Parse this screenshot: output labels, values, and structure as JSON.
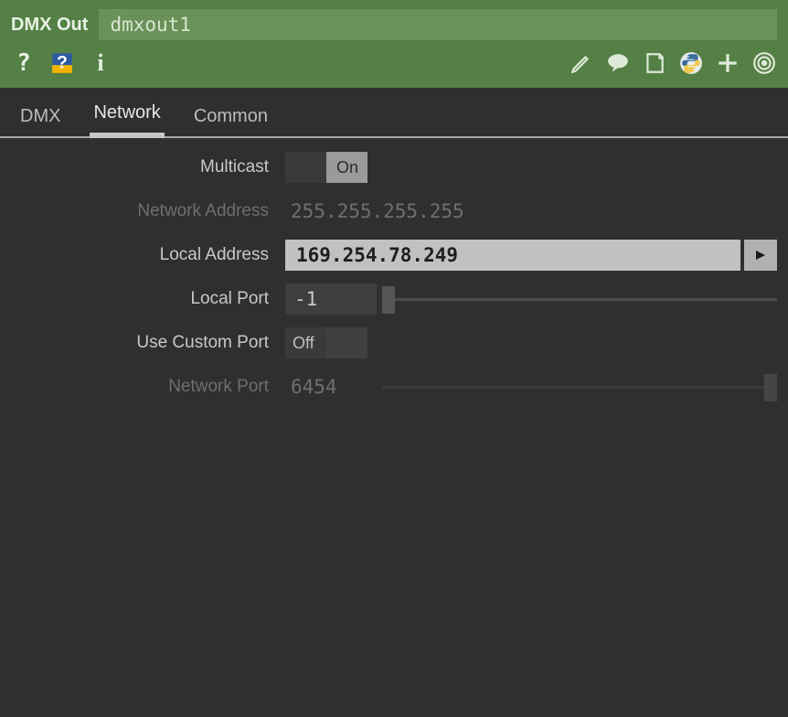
{
  "header": {
    "op_type": "DMX Out",
    "op_name": "dmxout1"
  },
  "toolbar_icons": {
    "help": "?",
    "context_help": "?",
    "info": "i",
    "edit": "pencil-icon",
    "comment": "speech-icon",
    "note": "note-icon",
    "python": "python-icon",
    "plus": "plus-icon",
    "target": "target-icon"
  },
  "tabs": [
    {
      "label": "DMX",
      "active": false
    },
    {
      "label": "Network",
      "active": true
    },
    {
      "label": "Common",
      "active": false
    }
  ],
  "params": {
    "multicast": {
      "label": "Multicast",
      "state": "On"
    },
    "network_address": {
      "label": "Network Address",
      "value": "255.255.255.255"
    },
    "local_address": {
      "label": "Local Address",
      "value": "169.254.78.249"
    },
    "local_port": {
      "label": "Local Port",
      "value": "-1",
      "slider_pos": 0.0
    },
    "use_custom_port": {
      "label": "Use Custom Port",
      "state": "Off"
    },
    "network_port": {
      "label": "Network Port",
      "value": "6454",
      "slider_pos": 1.0
    }
  }
}
